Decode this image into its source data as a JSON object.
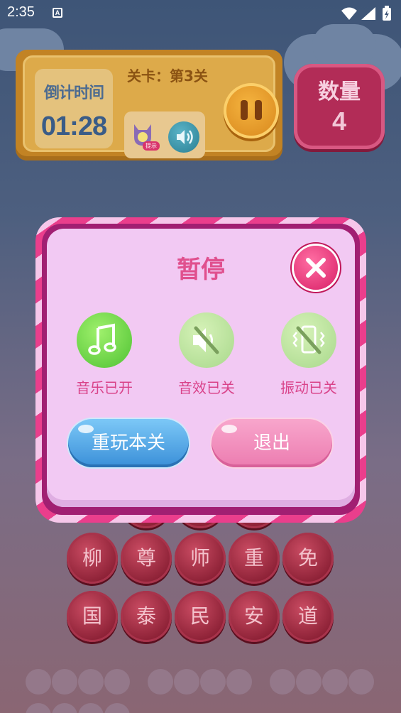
{
  "status_bar": {
    "time": "2:35",
    "indicator": "A"
  },
  "header": {
    "timer_label": "倒计时间",
    "timer_value": "01:28",
    "level_label": "关卡：第3关",
    "hint_tag": "提示",
    "icons": {
      "hint": "cat-bulb-icon",
      "sound": "speaker-icon",
      "pause": "pause-icon"
    }
  },
  "count": {
    "label": "数量",
    "value": "4"
  },
  "board": {
    "row1": [
      "柳",
      "尊",
      "师",
      "重",
      "免"
    ],
    "row2": [
      "国",
      "泰",
      "民",
      "安",
      "道"
    ]
  },
  "dialog": {
    "title": "暂停",
    "options": [
      {
        "label": "音乐已开",
        "icon": "music-note-icon",
        "state": "on"
      },
      {
        "label": "音效已关",
        "icon": "speaker-muted-icon",
        "state": "off"
      },
      {
        "label": "振动已关",
        "icon": "vibration-off-icon",
        "state": "off"
      }
    ],
    "replay_label": "重玩本关",
    "exit_label": "退出"
  },
  "colors": {
    "accent": "#e0508e",
    "frame": "#a11f72",
    "panel": "#f2c9f3"
  }
}
